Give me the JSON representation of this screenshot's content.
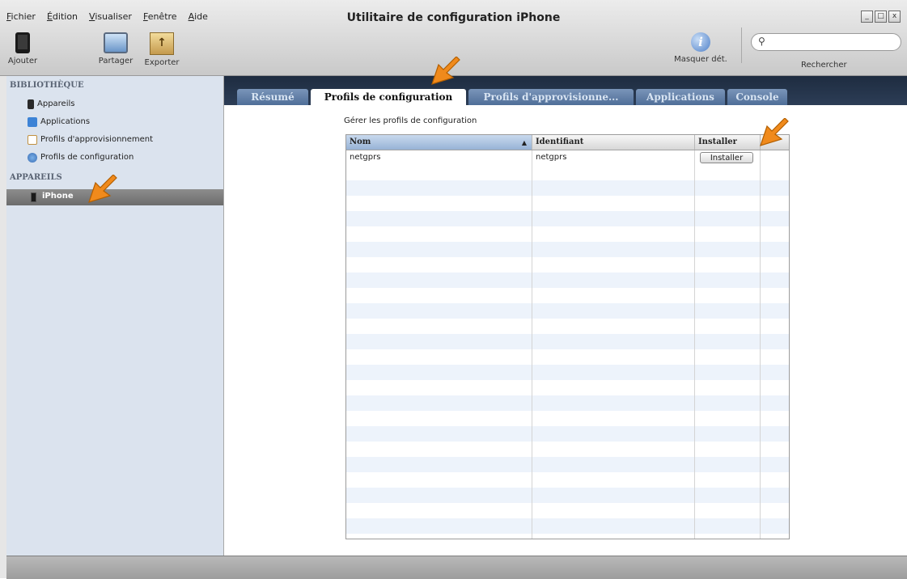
{
  "window": {
    "title": "Utilitaire de configuration iPhone",
    "controls": [
      "_",
      "□",
      "x"
    ]
  },
  "menu": [
    "Fichier",
    "Édition",
    "Visualiser",
    "Fenêtre",
    "Aide"
  ],
  "toolbar": {
    "add": "Ajouter",
    "share": "Partager",
    "export": "Exporter",
    "hide_details": "Masquer dét.",
    "search_label": "Rechercher",
    "search_value": ""
  },
  "sidebar": {
    "library_heading": "BIBLIOTHÈQUE",
    "library_items": [
      "Appareils",
      "Applications",
      "Profils d'approvisionnement",
      "Profils de configuration"
    ],
    "devices_heading": "APPAREILS",
    "device": "iPhone"
  },
  "tabs": [
    "Résumé",
    "Profils de configuration",
    "Profils d'approvisionne...",
    "Applications",
    "Console"
  ],
  "active_tab": "Profils de configuration",
  "content": {
    "subtitle": "Gérer les profils de configuration",
    "columns": [
      "Nom",
      "Identifiant",
      "Installer"
    ],
    "rows": [
      {
        "name": "netgprs",
        "identifier": "netgprs",
        "action": "Installer"
      }
    ]
  },
  "colors": {
    "tab_bar": "#24344b",
    "tab_inactive": "#5f7ea7",
    "sidebar": "#dbe3ee",
    "arrow": "#f08a1c",
    "stripe": "#edf3fb"
  }
}
